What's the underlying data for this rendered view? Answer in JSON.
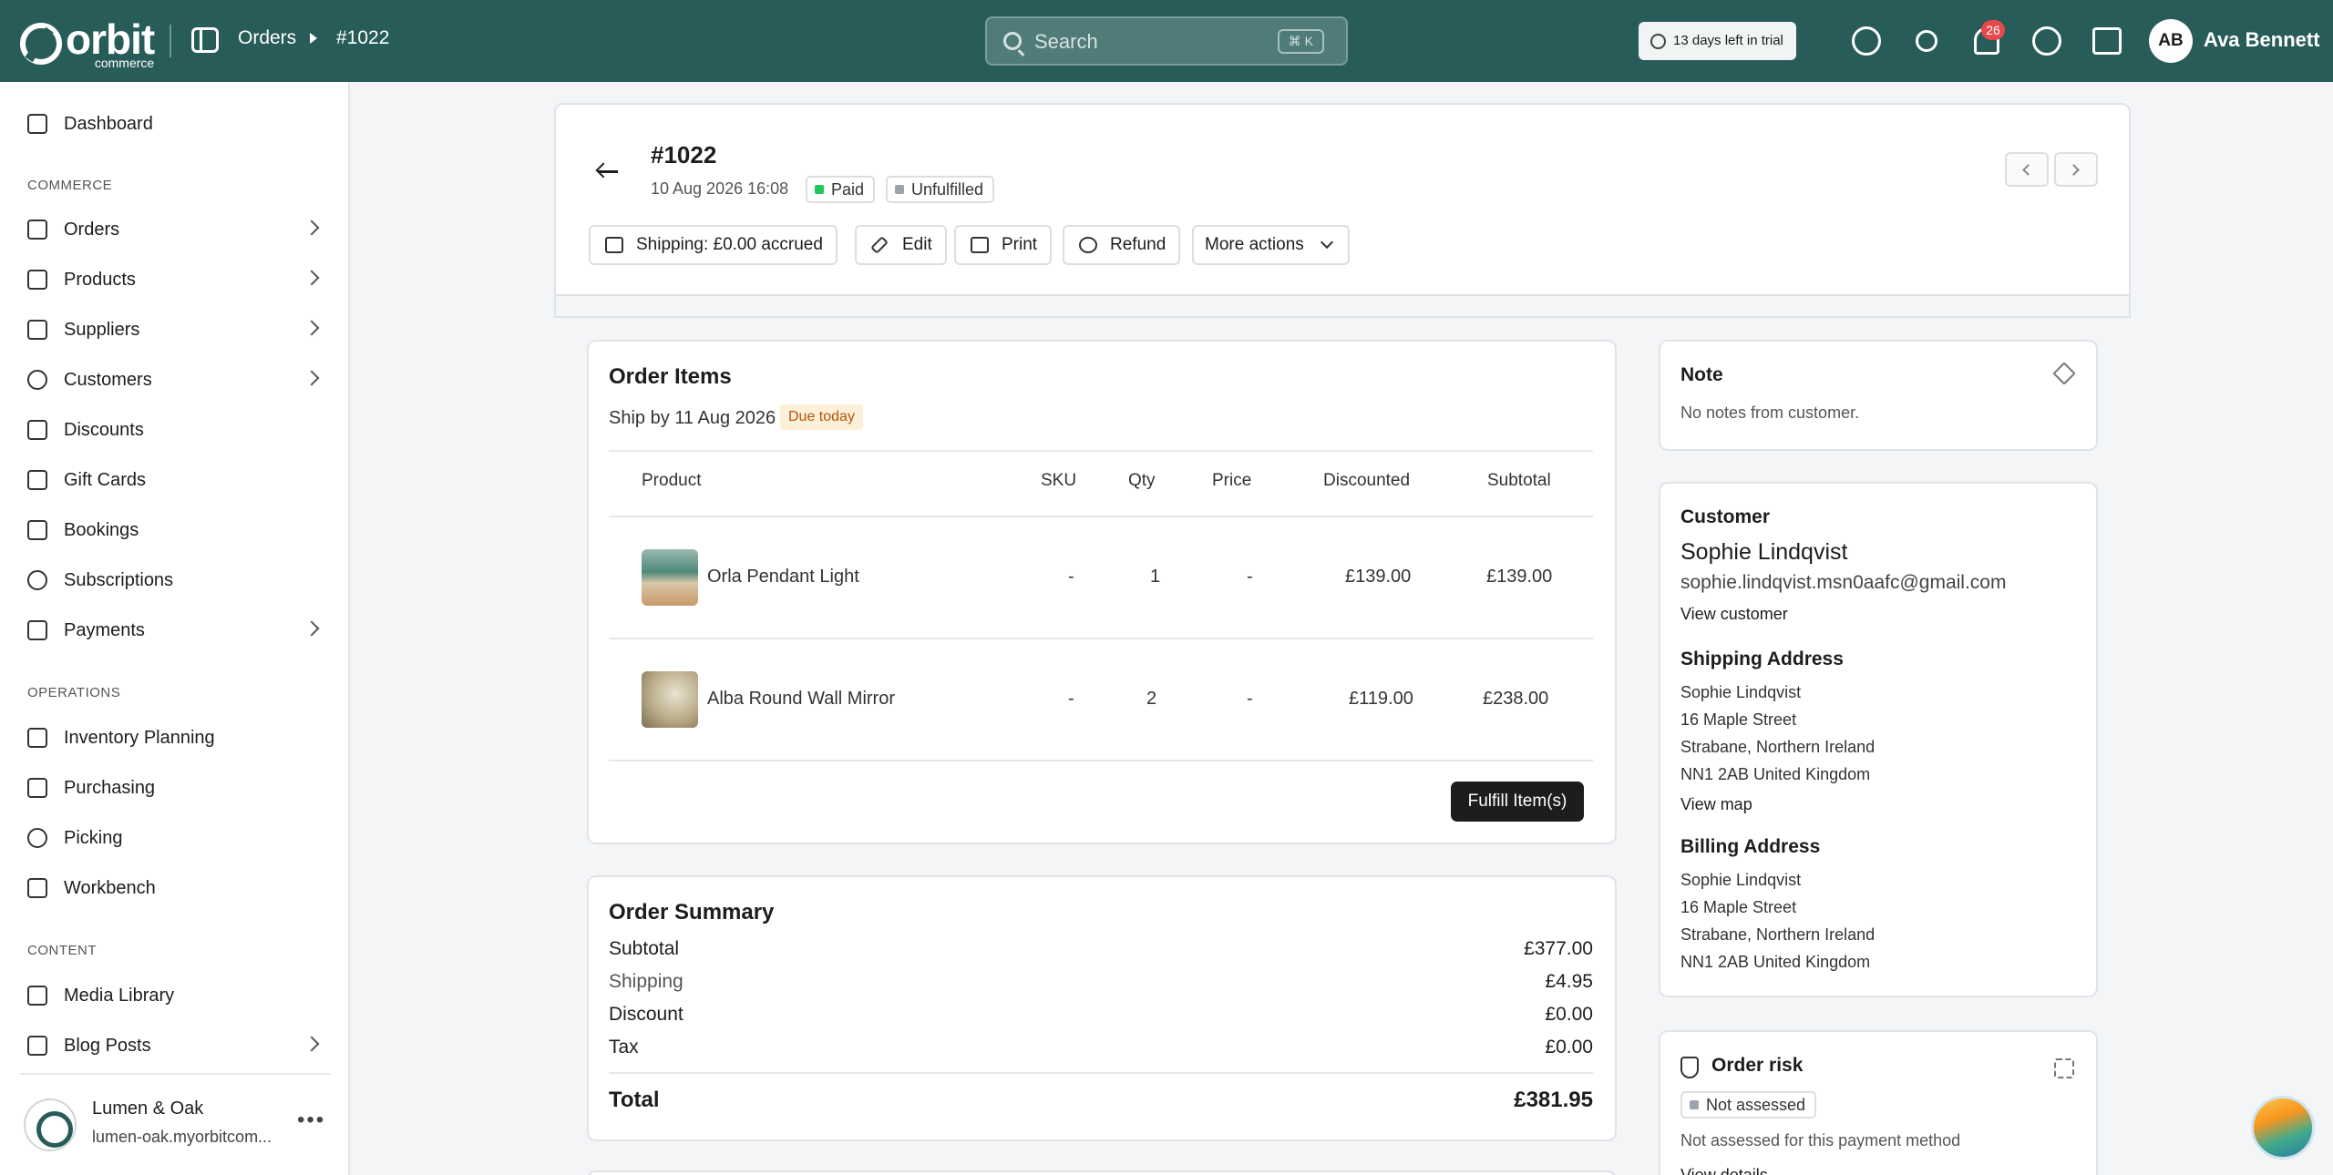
{
  "topbar": {
    "logo_big": "orbit",
    "logo_small": "commerce",
    "breadcrumb": [
      "Orders",
      "#1022"
    ],
    "search_placeholder": "Search",
    "search_shortcut": "⌘ K",
    "trial_text": "13 days left in trial",
    "notification_count": "26",
    "user_initials": "AB",
    "user_name": "Ava Bennett",
    "accent_color": "#275c59"
  },
  "sidebar": {
    "top_item": "Dashboard",
    "sections": [
      {
        "title": "COMMERCE",
        "items": [
          "Orders",
          "Products",
          "Suppliers",
          "Customers",
          "Discounts",
          "Gift Cards",
          "Bookings",
          "Subscriptions",
          "Payments"
        ]
      },
      {
        "title": "OPERATIONS",
        "items": [
          "Inventory Planning",
          "Purchasing",
          "Picking",
          "Workbench"
        ]
      },
      {
        "title": "CONTENT",
        "items": [
          "Media Library",
          "Blog Posts"
        ]
      }
    ],
    "store_name": "Lumen & Oak",
    "store_url": "lumen-oak.myorbitcom..."
  },
  "order": {
    "id": "#1022",
    "date": "10 Aug 2026 16:08",
    "payment_status": "Paid",
    "fulfillment_status": "Unfulfilled",
    "actions": [
      "Shipping: £0.00 accrued",
      "Edit",
      "Print",
      "Refund",
      "More actions"
    ]
  },
  "items_card": {
    "title": "Order Items",
    "ship_by": "Ship by 11 Aug 2026",
    "due_badge": "Due today",
    "columns": [
      "Product",
      "SKU",
      "Qty",
      "Price",
      "Discounted",
      "Subtotal"
    ],
    "rows": [
      {
        "product": "Orla Pendant Light",
        "sku": "-",
        "qty": "1",
        "price": "-",
        "discounted": "£139.00",
        "subtotal": "£139.00"
      },
      {
        "product": "Alba Round Wall Mirror",
        "sku": "-",
        "qty": "2",
        "price": "-",
        "discounted": "£119.00",
        "subtotal": "£238.00"
      }
    ],
    "fulfill_label": "Fulfill Item(s)"
  },
  "summary": {
    "title": "Order Summary",
    "subtotal_label": "Subtotal",
    "subtotal": "£377.00",
    "shipping_label": "Shipping",
    "shipping": "£4.95",
    "discount_label": "Discount",
    "discount": "£0.00",
    "tax_label": "Tax",
    "tax": "£0.00",
    "total_label": "Total",
    "total": "£381.95"
  },
  "note": {
    "title": "Note",
    "text": "No notes from customer."
  },
  "customer": {
    "title": "Customer",
    "name": "Sophie Lindqvist",
    "email": "sophie.lindqvist.msn0aafc@gmail.com",
    "view_link": "View customer",
    "shipping_title": "Shipping Address",
    "shipping_lines": [
      "Sophie Lindqvist",
      "16 Maple Street",
      "Strabane, Northern Ireland",
      "NN1 2AB United Kingdom"
    ],
    "map_link": "View map",
    "billing_title": "Billing Address",
    "billing_lines": [
      "Sophie Lindqvist",
      "16 Maple Street",
      "Strabane, Northern Ireland",
      "NN1 2AB United Kingdom"
    ]
  },
  "risk": {
    "title": "Order risk",
    "badge": "Not assessed",
    "text": "Not assessed for this payment method",
    "link": "View details"
  }
}
